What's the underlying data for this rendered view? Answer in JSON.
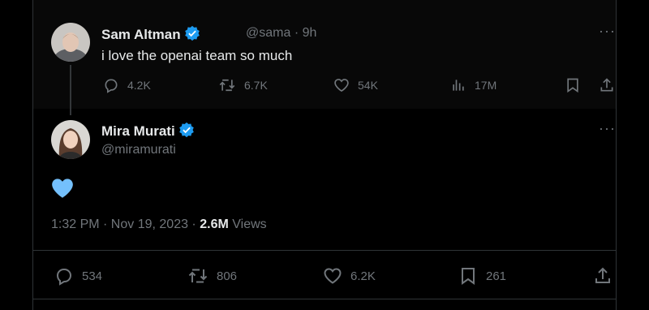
{
  "parent_tweet": {
    "name": "Sam Altman",
    "handle": "@sama",
    "separator": "·",
    "time": "9h",
    "text": "i love the openai team so much",
    "actions": {
      "replies": "4.2K",
      "reposts": "6.7K",
      "likes": "54K",
      "views": "17M"
    }
  },
  "main_tweet": {
    "name": "Mira Murati",
    "handle": "@miramurati",
    "content_emoji": "light-blue-heart",
    "timestamp": "1:32 PM · Nov 19, 2023 ·",
    "views_count": "2.6M",
    "views_label": "Views",
    "actions": {
      "replies": "534",
      "reposts": "806",
      "likes": "6.2K",
      "bookmarks": "261"
    }
  },
  "colors": {
    "background": "#000000",
    "text": "#e7e9ea",
    "muted": "#71767b",
    "verified": "#1d9bf0",
    "heart": "#74c0fc",
    "divider": "#2f3336"
  }
}
